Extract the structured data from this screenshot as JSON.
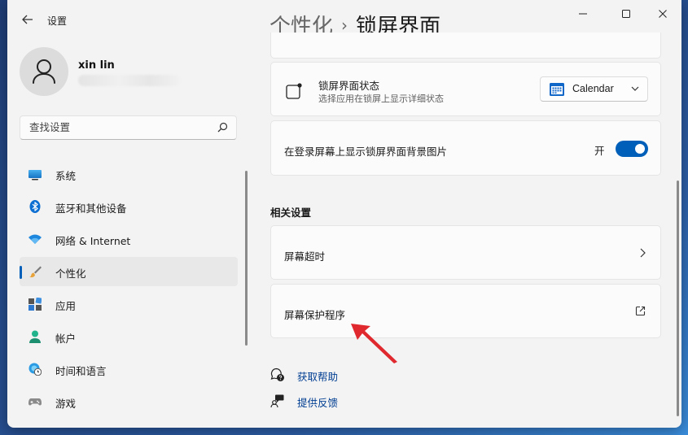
{
  "app": {
    "title": "设置"
  },
  "user": {
    "name": "xin lin"
  },
  "search": {
    "placeholder": "查找设置"
  },
  "nav": {
    "items": [
      {
        "label": "系统",
        "icon": "monitor-icon"
      },
      {
        "label": "蓝牙和其他设备",
        "icon": "bluetooth-icon"
      },
      {
        "label": "网络 & Internet",
        "icon": "wifi-icon"
      },
      {
        "label": "个性化",
        "icon": "brush-icon",
        "active": true
      },
      {
        "label": "应用",
        "icon": "apps-icon"
      },
      {
        "label": "帐户",
        "icon": "person-icon"
      },
      {
        "label": "时间和语言",
        "icon": "globe-clock-icon"
      },
      {
        "label": "游戏",
        "icon": "gamepad-icon"
      }
    ]
  },
  "breadcrumb": {
    "parent": "个性化",
    "separator": "›",
    "current": "锁屏界面"
  },
  "lock_status": {
    "title": "锁屏界面状态",
    "subtitle": "选择应用在锁屏上显示详细状态",
    "selected": "Calendar"
  },
  "background_on_signin": {
    "label": "在登录屏幕上显示锁屏界面背景图片",
    "toggle_state": "开",
    "on": true
  },
  "related": {
    "title": "相关设置",
    "screen_timeout": "屏幕超时",
    "screen_saver": "屏幕保护程序"
  },
  "links": {
    "help": "获取帮助",
    "feedback": "提供反馈"
  },
  "colors": {
    "accent": "#005fb8",
    "link": "#003e92",
    "annotation": "#e0292e"
  }
}
